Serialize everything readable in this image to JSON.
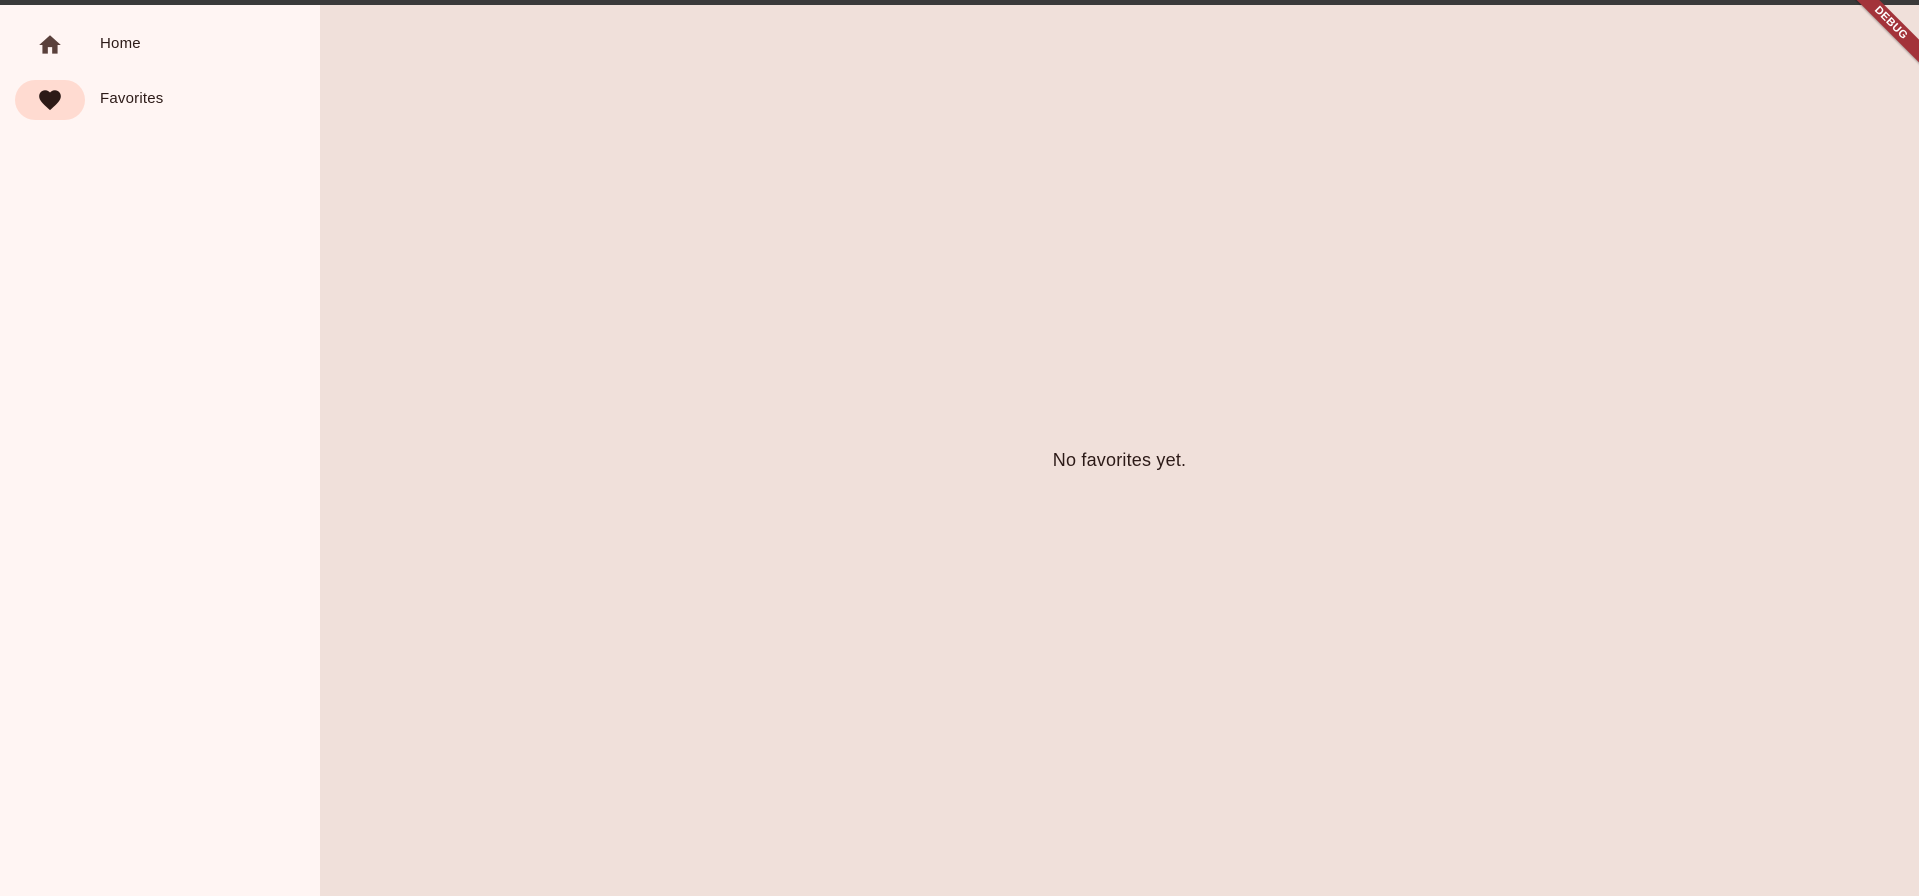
{
  "colors": {
    "nav_background": "#fff5f3",
    "content_background": "#f0e0da",
    "selected_indicator": "#ffdbd1",
    "text": "#2c1a17",
    "home_icon_color": "#5a403b",
    "favorites_icon_color": "#2c1a17",
    "debug_banner": "#a3333a"
  },
  "navigation": {
    "items": [
      {
        "label": "Home",
        "icon": "home-icon",
        "selected": false
      },
      {
        "label": "Favorites",
        "icon": "heart-icon",
        "selected": true
      }
    ]
  },
  "main": {
    "empty_message": "No favorites yet."
  },
  "debug_banner": {
    "label": "DEBUG"
  }
}
